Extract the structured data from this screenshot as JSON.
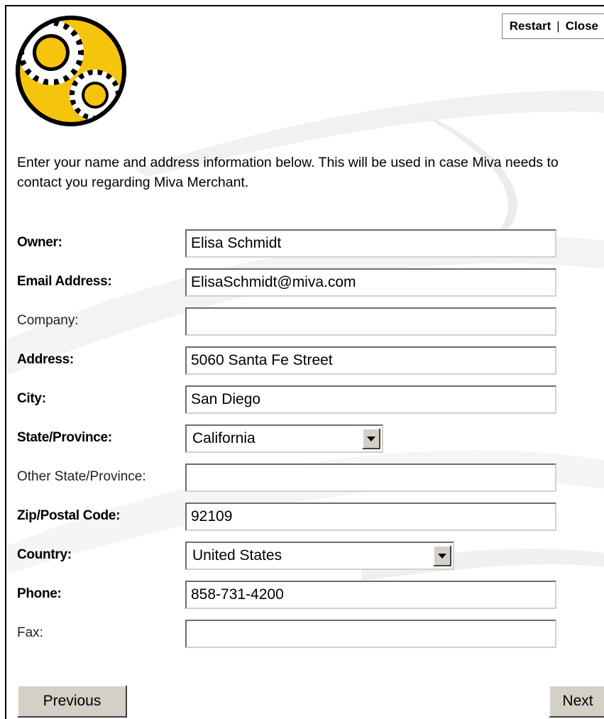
{
  "nav": {
    "restart_label": "Restart",
    "separator": "|",
    "close_label": "Close"
  },
  "logo": {
    "icon": "gears-logo",
    "colors": {
      "circle": "#f6c40c",
      "gear": "#ffffff",
      "outline": "#000000"
    }
  },
  "intro_text": "Enter your name and address information below. This will be used in case Miva needs to contact you regarding Miva Merchant.",
  "form": {
    "owner": {
      "label": "Owner:",
      "value": "Elisa Schmidt",
      "required": true
    },
    "email": {
      "label": "Email Address:",
      "value": "ElisaSchmidt@miva.com",
      "required": true
    },
    "company": {
      "label": "Company:",
      "value": "",
      "required": false
    },
    "address": {
      "label": "Address:",
      "value": "5060 Santa Fe Street",
      "required": true
    },
    "city": {
      "label": "City:",
      "value": "San Diego",
      "required": true
    },
    "state": {
      "label": "State/Province:",
      "value": "California",
      "required": true
    },
    "other_state": {
      "label": "Other State/Province:",
      "value": "",
      "required": false
    },
    "zip": {
      "label": "Zip/Postal Code:",
      "value": "92109",
      "required": true
    },
    "country": {
      "label": "Country:",
      "value": "United States",
      "required": true
    },
    "phone": {
      "label": "Phone:",
      "value": "858-731-4200",
      "required": true
    },
    "fax": {
      "label": "Fax:",
      "value": "",
      "required": false
    }
  },
  "buttons": {
    "previous_label": "Previous",
    "next_label": "Next"
  }
}
